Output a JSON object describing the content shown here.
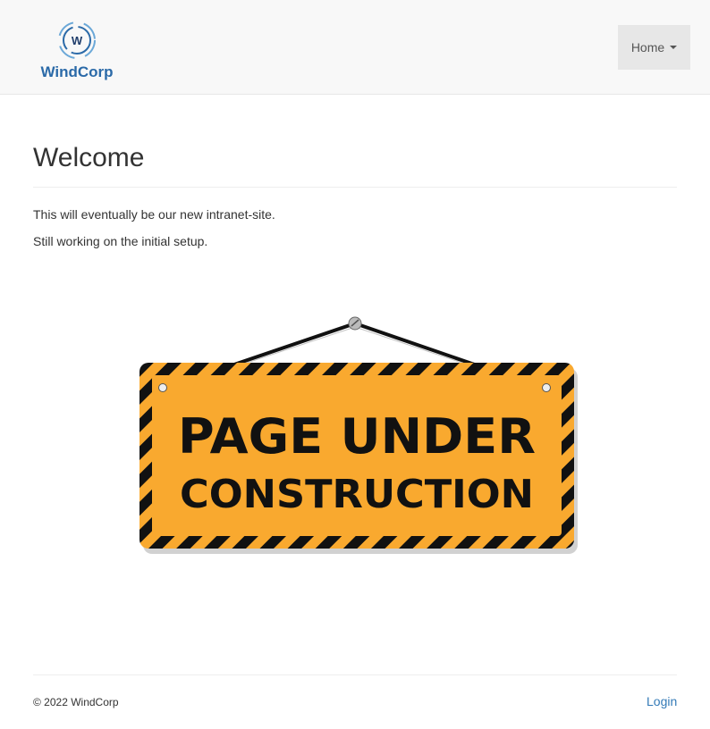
{
  "brand": {
    "name": "WindCorp",
    "monogram": "W"
  },
  "nav": {
    "home_label": "Home"
  },
  "main": {
    "title": "Welcome",
    "paragraphs": [
      "This will eventually be our new intranet-site.",
      "Still working on the initial setup."
    ],
    "sign": {
      "line1": "PAGE UNDER",
      "line2": "CONSTRUCTION"
    }
  },
  "footer": {
    "copyright": "© 2022 WindCorp",
    "login_label": "Login"
  },
  "colors": {
    "navbar_bg": "#f8f8f8",
    "nav_active_bg": "#e7e7e7",
    "link": "#337ab7",
    "sign_orange": "#f9a92f",
    "brand_blue": "#2b6aa8"
  }
}
